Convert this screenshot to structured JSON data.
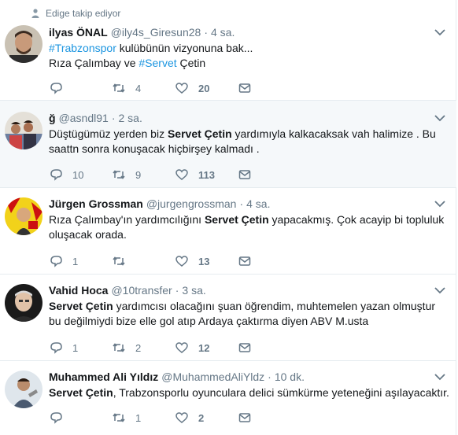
{
  "context": {
    "text": "Edige takip ediyor"
  },
  "tweets": [
    {
      "name": "ilyas ÖNAL",
      "handle": "@ily4s_Giresun28",
      "time": "4 sa.",
      "line1": {
        "hashtag": "#Trabzonspor",
        "rest": " kulübünün vizyonuna bak..."
      },
      "line2": {
        "pre": "Rıza Çalımbay ve ",
        "hashtag": "#Servet",
        "post": " Çetin"
      },
      "reply": "",
      "retweet": "4",
      "like": "20"
    },
    {
      "name": "ğ",
      "handle": "@asndl91",
      "time": "2 sa.",
      "pre": "Düştügümüz yerden biz ",
      "bold": "Servet Çetin",
      "post": " yardımıyla kalkacaksak vah halimize . Bu saattn sonra konuşacak hiçbirşey kalmadı .",
      "reply": "10",
      "retweet": "9",
      "like": "113"
    },
    {
      "name": "Jürgen Grossman",
      "handle": "@jurgengrossman",
      "time": "4 sa.",
      "pre": "Rıza Çalımbay'ın yardımcılığını ",
      "bold": "Servet Çetin",
      "post": " yapacakmış. Çok acayip bi topluluk oluşacak orada.",
      "reply": "1",
      "retweet": "",
      "like": "13"
    },
    {
      "name": "Vahid Hoca",
      "handle": "@10transfer",
      "time": "3 sa.",
      "pre": "",
      "bold": "Servet Çetin",
      "post": " yardımcısı olacağını şuan öğrendim, muhtemelen yazan olmuştur bu değilmiydi bize elle gol atıp Ardaya çaktırma diyen ABV M.usta",
      "reply": "1",
      "retweet": "2",
      "like": "12"
    },
    {
      "name": "Muhammed Ali Yıldız",
      "handle": "@MuhammedAliYldz",
      "time": "10 dk.",
      "pre": "",
      "bold": "Servet Çetin",
      "post": ", Trabzonsporlu oyunculara delici sümkürme yeteneğini aşılayacaktır.",
      "reply": "",
      "retweet": "1",
      "like": "2"
    }
  ],
  "colors": {
    "link": "#1b95e0",
    "muted": "#657786",
    "highlight_bg": "#f5f8fa"
  },
  "icons": [
    "person-icon",
    "reply-icon",
    "retweet-icon",
    "like-icon",
    "message-icon",
    "chevron-down-icon"
  ]
}
